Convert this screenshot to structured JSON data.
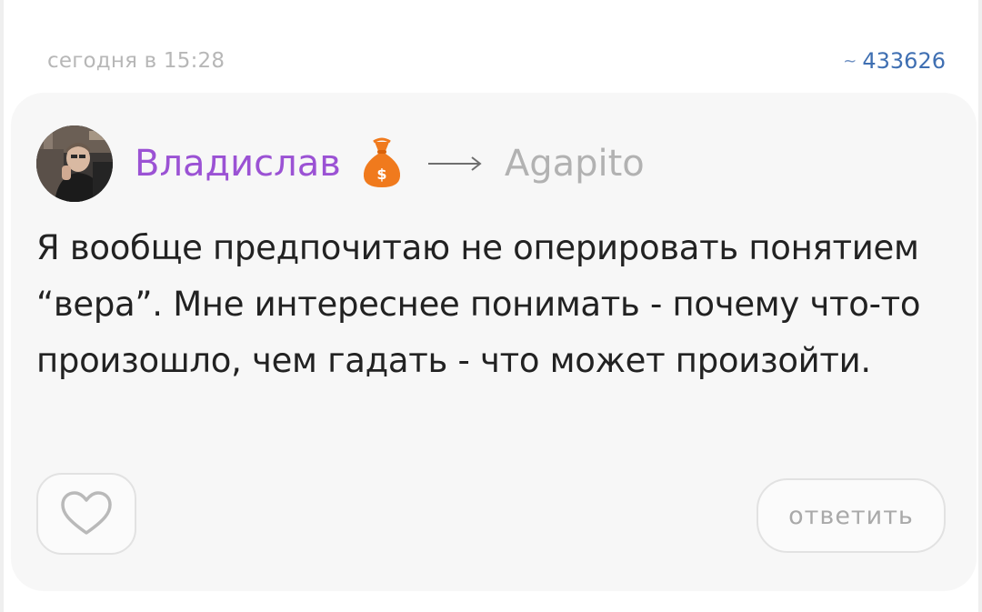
{
  "comment": {
    "timestamp": "сегодня в 15:28",
    "post_link": {
      "prefix": "~",
      "id": "433626"
    },
    "author": {
      "name": "Владислав",
      "badge_icon": "money-bag-icon"
    },
    "recipient": {
      "name": "Agapito"
    },
    "text": "Я вообще предпочитаю не оперировать понятием “вера”. Мне интереснее понимать - почему что-то произошло, чем гадать - что может произойти.",
    "actions": {
      "like_icon": "heart-icon",
      "reply_label": "ответить"
    }
  },
  "colors": {
    "author": "#9b52d4",
    "recipient": "#b2b2b2",
    "link": "#3f6fb2",
    "badge": "#f07a1d",
    "card_background": "#f7f7f7"
  }
}
